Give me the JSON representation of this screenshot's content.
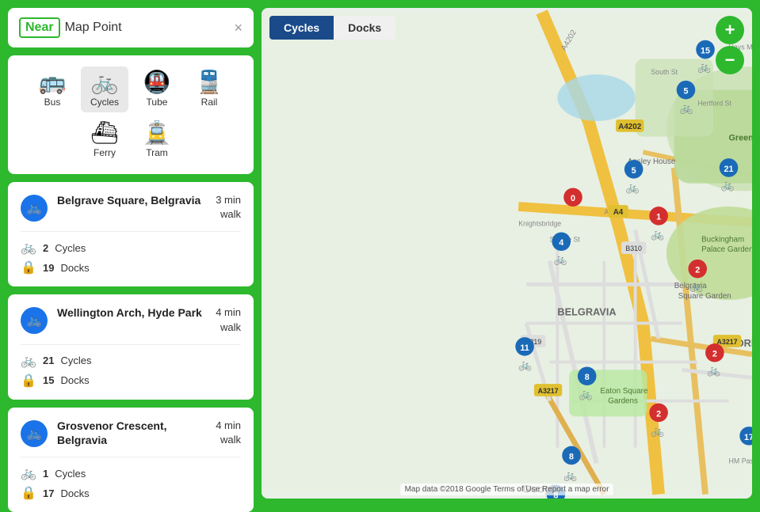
{
  "search": {
    "near_label": "Near",
    "map_point": "Map Point",
    "close": "×"
  },
  "transport_modes": [
    {
      "id": "bus",
      "label": "Bus",
      "icon": "🚌",
      "active": false
    },
    {
      "id": "cycles",
      "label": "Cycles",
      "icon": "🚲",
      "active": true
    },
    {
      "id": "tube",
      "label": "Tube",
      "icon": "🚇",
      "active": false
    },
    {
      "id": "rail",
      "label": "Rail",
      "icon": "🚆",
      "active": false
    },
    {
      "id": "ferry",
      "label": "Ferry",
      "icon": "⛴",
      "active": false
    },
    {
      "id": "tram",
      "label": "Tram",
      "icon": "🚊",
      "active": false
    }
  ],
  "stations": [
    {
      "name": "Belgrave Square, Belgravia",
      "time": "3 min\nwalk",
      "cycles": 2,
      "docks": 19
    },
    {
      "name": "Wellington Arch, Hyde Park",
      "time": "4 min\nwalk",
      "cycles": 21,
      "docks": 15
    },
    {
      "name": "Grosvenor Crescent, Belgravia",
      "time": "4 min\nwalk",
      "cycles": 1,
      "docks": 17
    }
  ],
  "map": {
    "tabs": [
      "Cycles",
      "Docks"
    ],
    "active_tab": "Cycles",
    "zoom_in": "+",
    "zoom_out": "−",
    "attribution": "Map data ©2018 Google   Terms of Use   Report a map error"
  }
}
